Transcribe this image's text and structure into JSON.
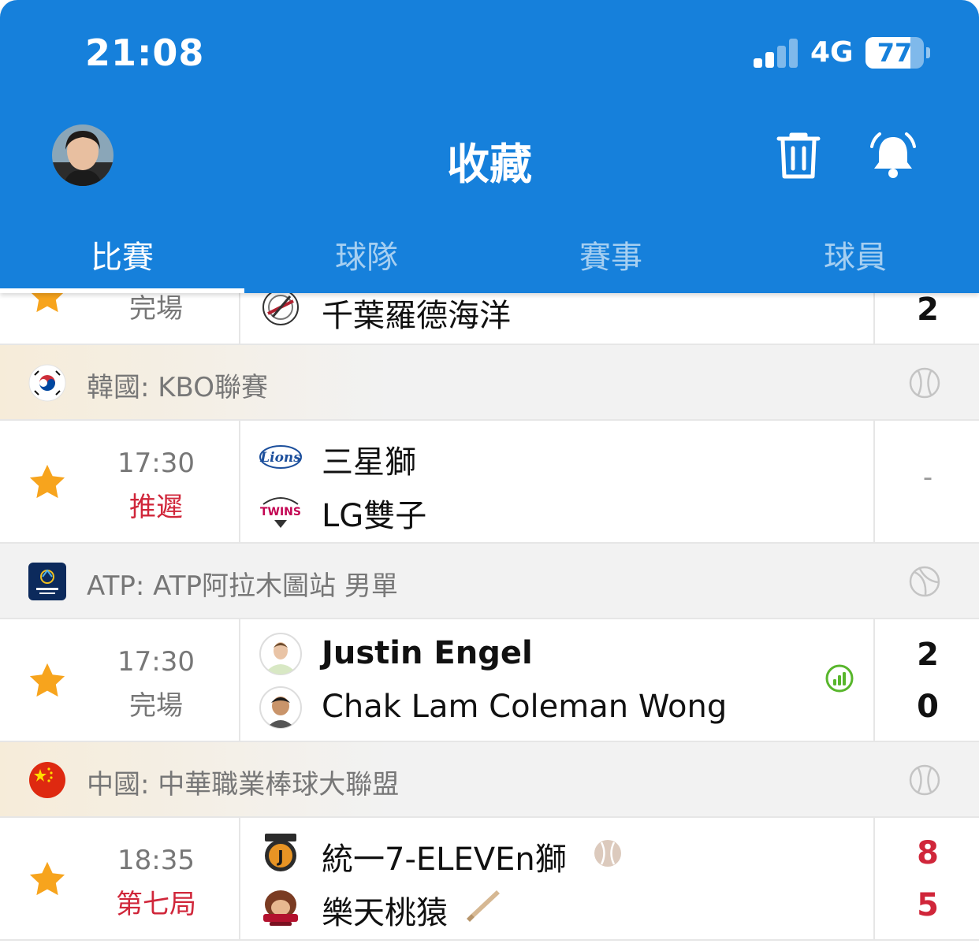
{
  "status_bar": {
    "time": "21:08",
    "network": "4G",
    "battery": "77",
    "battery_level": 0.77
  },
  "header": {
    "title": "收藏"
  },
  "tabs": [
    {
      "label": "比賽",
      "active": true
    },
    {
      "label": "球隊",
      "active": false
    },
    {
      "label": "賽事",
      "active": false
    },
    {
      "label": "球員",
      "active": false
    }
  ],
  "top_partial_row": {
    "status": "完場",
    "team": "千葉羅德海洋",
    "score": "2"
  },
  "sections": [
    {
      "league": "韓國: KBO聯賽",
      "flag_icon": "korea-flag-icon",
      "sport_icon": "baseball-icon",
      "match": {
        "time": "17:30",
        "status": "推遲",
        "status_color": "#d0263a",
        "home": {
          "name": "三星獅",
          "logo": "samsung-lions-logo"
        },
        "away": {
          "name": "LG雙子",
          "logo": "lg-twins-logo"
        },
        "score_placeholder": "-"
      }
    },
    {
      "league": "ATP: ATP阿拉木圖站 男單",
      "flag_icon": "astana-open-logo",
      "sport_icon": "tennis-icon",
      "match": {
        "time": "17:30",
        "status": "完場",
        "status_color": "#777777",
        "home": {
          "name": "Justin Engel",
          "logo": "player-avatar",
          "score": "2"
        },
        "away": {
          "name": "Chak Lam Coleman Wong",
          "logo": "player-avatar",
          "score": "0"
        },
        "stats_icon": "stats-icon"
      }
    },
    {
      "league": "中國: 中華職業棒球大聯盟",
      "flag_icon": "china-flag-icon",
      "sport_icon": "baseball-icon",
      "match": {
        "time": "18:35",
        "status": "第七局",
        "status_color": "#d0263a",
        "home": {
          "name": "統一7-ELEVEn獅",
          "logo": "uni-lions-logo",
          "score": "8",
          "extra_icon": "baseball-icon"
        },
        "away": {
          "name": "樂天桃猿",
          "logo": "rakuten-monkeys-logo",
          "score": "5",
          "extra_icon": "bat-icon"
        },
        "score_color": "#d0263a"
      }
    }
  ],
  "colors": {
    "brand": "#1680db",
    "star": "#f7a41d",
    "live": "#d0263a"
  }
}
